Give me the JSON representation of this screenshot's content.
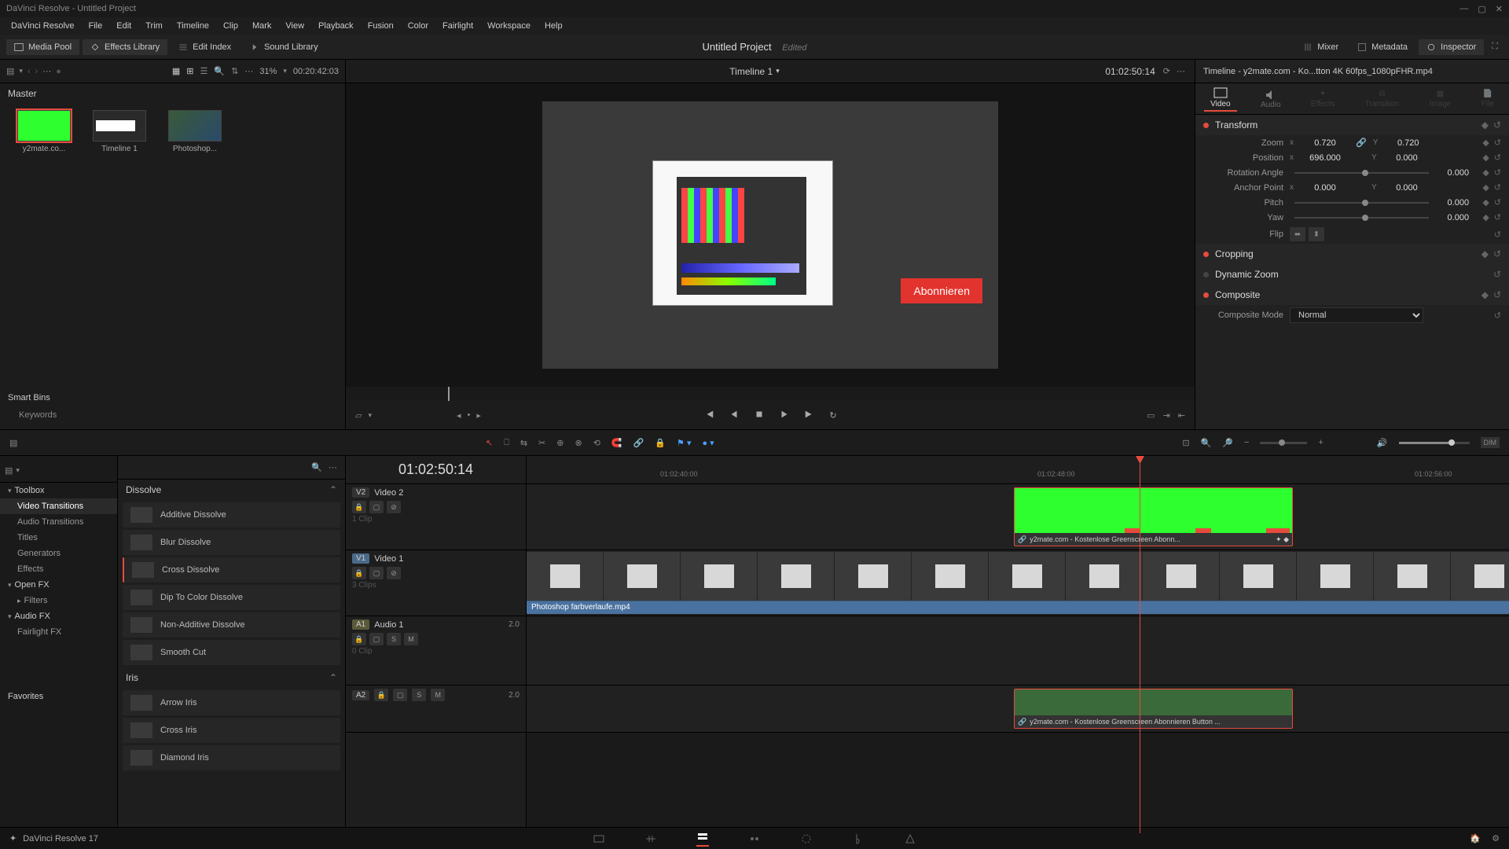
{
  "titlebar": {
    "app": "DaVinci Resolve",
    "project": "Untitled Project"
  },
  "menu": [
    "DaVinci Resolve",
    "File",
    "Edit",
    "Trim",
    "Timeline",
    "Clip",
    "Mark",
    "View",
    "Playback",
    "Fusion",
    "Color",
    "Fairlight",
    "Workspace",
    "Help"
  ],
  "top_toolbar": {
    "media_pool": "Media Pool",
    "effects_lib": "Effects Library",
    "edit_index": "Edit Index",
    "sound_lib": "Sound Library",
    "project_title": "Untitled Project",
    "edited": "Edited",
    "mixer": "Mixer",
    "metadata": "Metadata",
    "inspector": "Inspector"
  },
  "media_pool": {
    "zoom": "31%",
    "tc": "00:20:42:03",
    "master": "Master",
    "thumbs": [
      {
        "label": "y2mate.co..."
      },
      {
        "label": "Timeline 1"
      },
      {
        "label": "Photoshop..."
      }
    ],
    "smart_bins": "Smart Bins",
    "keywords": "Keywords"
  },
  "viewer": {
    "title": "Timeline 1",
    "tc_right": "01:02:50:14",
    "overlay_btn": "Abonnieren"
  },
  "inspector": {
    "header": "Timeline - y2mate.com - Ko...tton 4K 60fps_1080pFHR.mp4",
    "tabs": [
      "Video",
      "Audio",
      "Effects",
      "Transition",
      "Image",
      "File"
    ],
    "transform": {
      "title": "Transform",
      "zoom_label": "Zoom",
      "zoom_x": "0.720",
      "zoom_y": "0.720",
      "position_label": "Position",
      "pos_x": "696.000",
      "pos_y": "0.000",
      "rotation_label": "Rotation Angle",
      "rotation": "0.000",
      "anchor_label": "Anchor Point",
      "anchor_x": "0.000",
      "anchor_y": "0.000",
      "pitch_label": "Pitch",
      "pitch": "0.000",
      "yaw_label": "Yaw",
      "yaw": "0.000",
      "flip_label": "Flip"
    },
    "cropping": "Cropping",
    "dynamic_zoom": "Dynamic Zoom",
    "composite": "Composite",
    "composite_mode_label": "Composite Mode",
    "composite_mode": "Normal"
  },
  "fx": {
    "toolbox": "Toolbox",
    "tree": [
      "Video Transitions",
      "Audio Transitions",
      "Titles",
      "Generators",
      "Effects"
    ],
    "openfx": "Open FX",
    "filters": "Filters",
    "audiofx": "Audio FX",
    "fairlightfx": "Fairlight FX",
    "favorites": "Favorites",
    "cat_dissolve": "Dissolve",
    "dissolve_items": [
      "Additive Dissolve",
      "Blur Dissolve",
      "Cross Dissolve",
      "Dip To Color Dissolve",
      "Non-Additive Dissolve",
      "Smooth Cut"
    ],
    "cat_iris": "Iris",
    "iris_items": [
      "Arrow Iris",
      "Cross Iris",
      "Diamond Iris"
    ]
  },
  "timeline": {
    "tc": "01:02:50:14",
    "ruler": [
      "01:02:40:00",
      "01:02:48:00",
      "01:02:56:00"
    ],
    "tracks": {
      "v2": {
        "badge": "V2",
        "name": "Video 2",
        "sub": "1 Clip"
      },
      "v1": {
        "badge": "V1",
        "name": "Video 1",
        "sub": "3 Clips"
      },
      "a1": {
        "badge": "A1",
        "name": "Audio 1",
        "ch": "2.0",
        "sub": "0 Clip"
      },
      "a2": {
        "badge": "A2",
        "ch": "2.0"
      }
    },
    "clip_v2": "y2mate.com - Kostenlose Greenscreen Abonn...",
    "clip_v1": "Photoshop farbverlaufe.mp4",
    "clip_a2": "y2mate.com - Kostenlose Greenscreen Abonnieren Button ..."
  },
  "footer": {
    "app_version": "DaVinci Resolve 17"
  }
}
